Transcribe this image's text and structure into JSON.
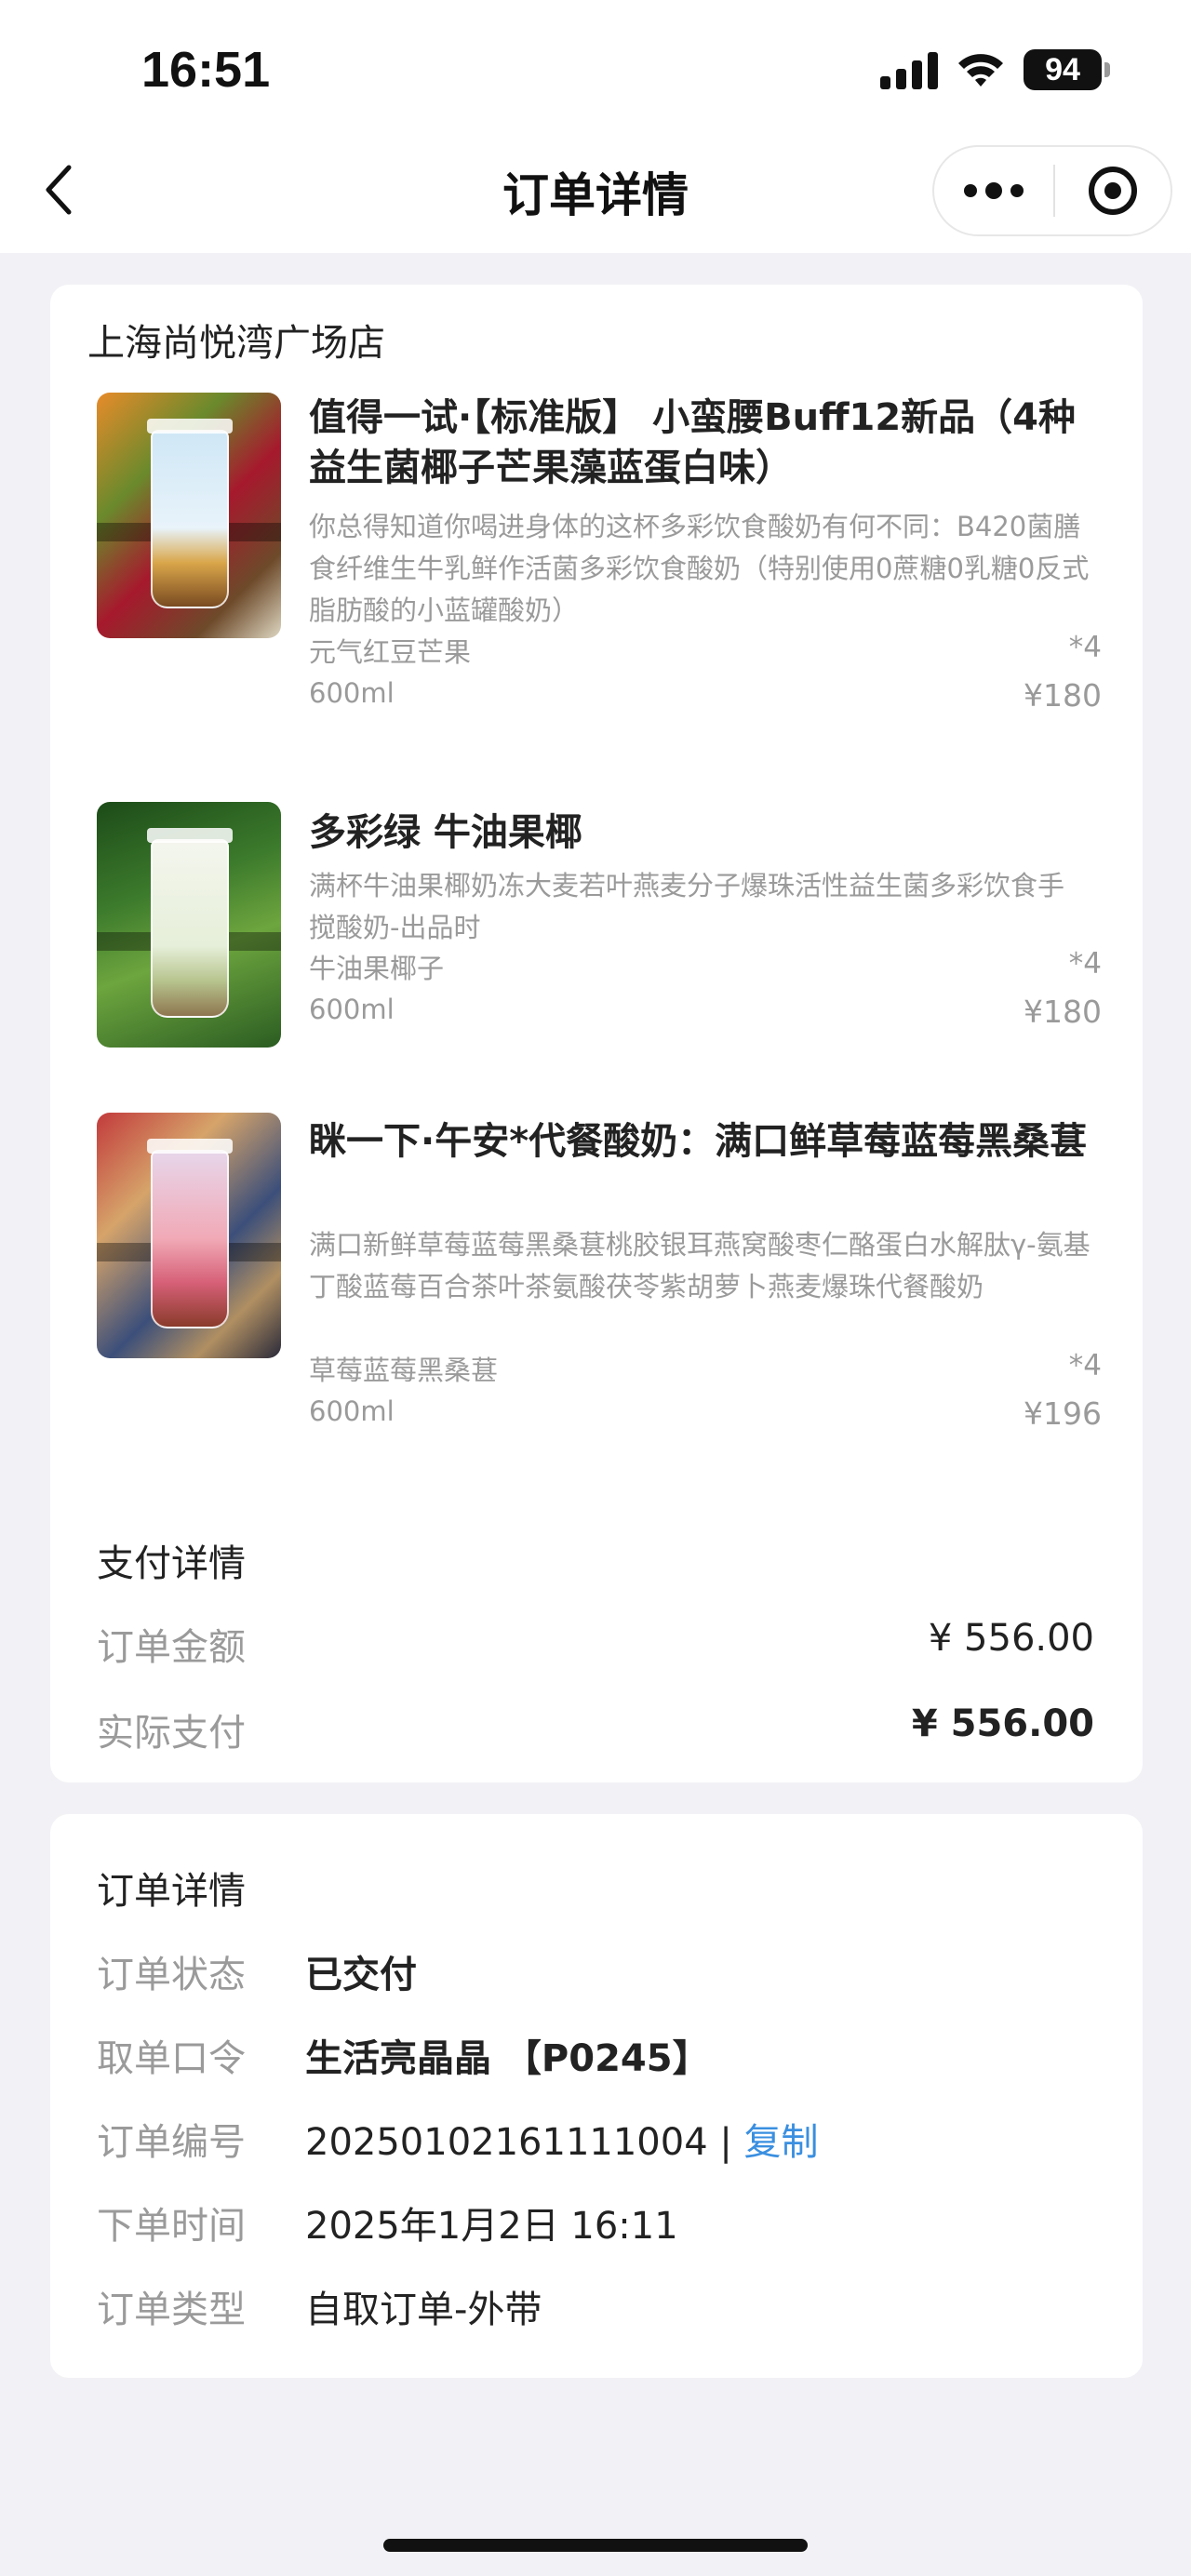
{
  "status_bar": {
    "time": "16:51",
    "battery": "94"
  },
  "nav": {
    "title": "订单详情"
  },
  "store": {
    "name": "上海尚悦湾广场店"
  },
  "products": [
    {
      "name": "值得一试·【标准版】 小蛮腰Buff12新品（4种益生菌椰子芒果藻蓝蛋白味）",
      "description": "你总得知道你喝进身体的这杯多彩饮食酸奶有何不同：B420菌膳食纤维生牛乳鲜作活菌多彩饮食酸奶（特别使用0蔗糖0乳糖0反式脂肪酸的小蓝罐酸奶）",
      "flavor": "元气红豆芒果",
      "size": "600ml",
      "quantity": "*4",
      "price": "¥180"
    },
    {
      "name": "多彩绿 牛油果椰",
      "description": "满杯牛油果椰奶冻大麦若叶燕麦分子爆珠活性益生菌多彩饮食手搅酸奶-出品时",
      "flavor": "牛油果椰子",
      "size": "600ml",
      "quantity": "*4",
      "price": "¥180"
    },
    {
      "name": "眯一下·午安*代餐酸奶：满口鲜草莓蓝莓黑桑葚",
      "description": "满口新鲜草莓蓝莓黑桑葚桃胶银耳燕窝酸枣仁酪蛋白水解肽γ-氨基丁酸蓝莓百合茶叶茶氨酸茯苓紫胡萝卜燕麦爆珠代餐酸奶",
      "flavor": "草莓蓝莓黑桑葚",
      "size": "600ml",
      "quantity": "*4",
      "price": "¥196"
    }
  ],
  "payment": {
    "title": "支付详情",
    "order_amount_label": "订单金额",
    "order_amount": "¥ 556.00",
    "paid_label": "实际支付",
    "paid_amount": "¥ 556.00"
  },
  "order": {
    "title": "订单详情",
    "status_label": "订单状态",
    "status_value": "已交付",
    "pickup_label": "取单口令",
    "pickup_value": "生活亮晶晶 【P0245】",
    "number_label": "订单编号",
    "number_value": "20250102161111004",
    "separator": " | ",
    "copy_label": "复制",
    "time_label": "下单时间",
    "time_value": "2025年1月2日 16:11",
    "type_label": "订单类型",
    "type_value": "自取订单-外带"
  }
}
